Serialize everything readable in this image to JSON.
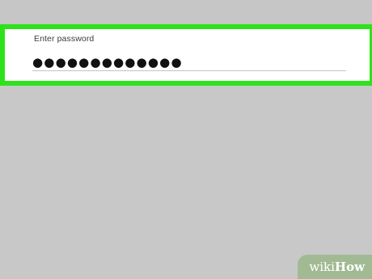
{
  "password_field": {
    "label": "Enter password",
    "value": "●●●●●●●●●●●●●"
  },
  "watermark": {
    "brand_prefix": "wiki",
    "brand_suffix": "How"
  },
  "colors": {
    "highlight": "#2ee21a",
    "background": "#c8c8c8",
    "panel": "#ffffff"
  }
}
